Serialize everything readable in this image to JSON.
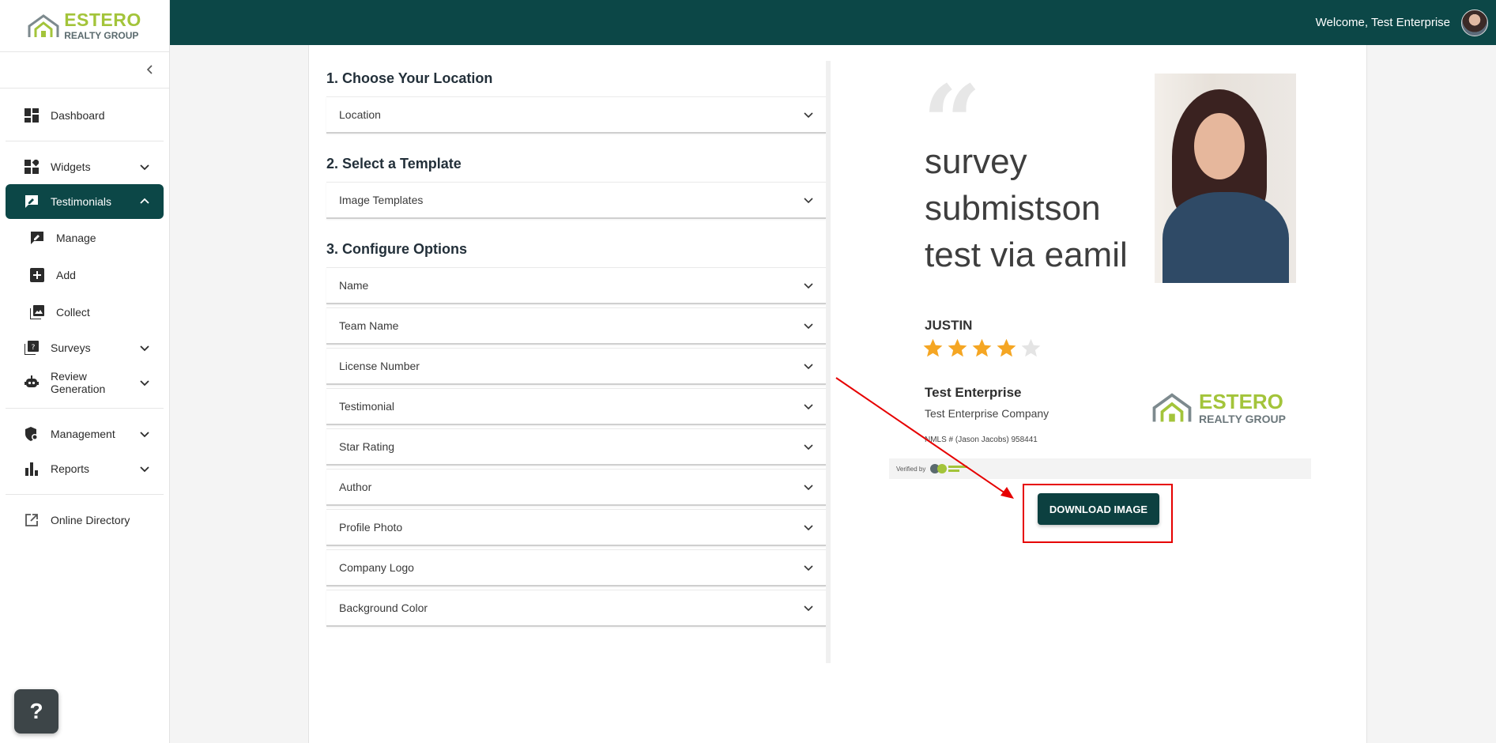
{
  "brand": {
    "line1": "ESTERO",
    "line2": "REALTY GROUP"
  },
  "header": {
    "welcome": "Welcome, Test Enterprise"
  },
  "sidebar": {
    "items": [
      {
        "label": "Dashboard"
      },
      {
        "label": "Widgets"
      },
      {
        "label": "Testimonials"
      },
      {
        "label": "Manage"
      },
      {
        "label": "Add"
      },
      {
        "label": "Collect"
      },
      {
        "label": "Surveys"
      },
      {
        "label": "Review Generation"
      },
      {
        "label": "Management"
      },
      {
        "label": "Reports"
      },
      {
        "label": "Online Directory"
      }
    ]
  },
  "help": {
    "label": "?"
  },
  "config": {
    "step1": {
      "title": "1. Choose Your Location",
      "options": [
        "Location"
      ]
    },
    "step2": {
      "title": "2. Select a Template",
      "options": [
        "Image Templates"
      ]
    },
    "step3": {
      "title": "3. Configure Options",
      "options": [
        "Name",
        "Team Name",
        "License Number",
        "Testimonial",
        "Star Rating",
        "Author",
        "Profile Photo",
        "Company Logo",
        "Background Color"
      ]
    }
  },
  "preview": {
    "testimonial": "survey submistson test via eamil",
    "author": "JUSTIN",
    "rating": 4,
    "rating_max": 5,
    "enterprise_name": "Test Enterprise",
    "company": "Test Enterprise Company",
    "nmls": "NMLS # (Jason Jacobs) 958441",
    "verified_by": "Verified by"
  },
  "actions": {
    "download": "DOWNLOAD IMAGE"
  },
  "colors": {
    "primary": "#0c4747",
    "accent": "#a3c43a",
    "star": "#f5a623",
    "highlight": "#e60000"
  }
}
